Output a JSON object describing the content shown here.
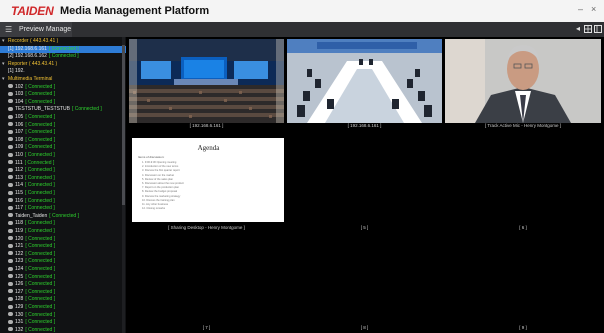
{
  "app": {
    "brand": "TAIDEN",
    "title": "Media Management Platform"
  },
  "window_controls": [
    "–",
    "×"
  ],
  "tabbar": {
    "tab_label": "Preview Manage",
    "tab_icon": "list-icon",
    "right_buttons": [
      "back-icon",
      "grid-view-icon",
      "layout-icon"
    ]
  },
  "sidebar": {
    "items": [
      {
        "level": 0,
        "type": "group",
        "mark": "▾",
        "name": "Recorder ( 443.43.41 )",
        "status": ""
      },
      {
        "level": 1,
        "type": "device",
        "mark": "",
        "name": "[1] 192.168.6.161",
        "status": "[ Connected ]",
        "selected": true
      },
      {
        "level": 1,
        "type": "device",
        "mark": "",
        "name": "[2] 192.168.6.162",
        "status": "[ Connected ]"
      },
      {
        "level": 0,
        "type": "group",
        "mark": "▾",
        "name": "Reporter ( 443.43.41 )",
        "status": ""
      },
      {
        "level": 1,
        "type": "device",
        "mark": "",
        "name": "[1] 192.",
        "status": ""
      },
      {
        "level": 0,
        "type": "group",
        "mark": "▾",
        "name": "Multimedia Terminal",
        "status": ""
      },
      {
        "level": 1,
        "type": "user",
        "name": "102",
        "status": "[ Connected ]"
      },
      {
        "level": 1,
        "type": "user",
        "name": "103",
        "status": "[ Connected ]"
      },
      {
        "level": 1,
        "type": "user",
        "name": "104",
        "status": "[ Connected ]"
      },
      {
        "level": 1,
        "type": "user",
        "name": "TESTSTUB_TESTSTUB",
        "status": "[ Connected ]"
      },
      {
        "level": 1,
        "type": "user",
        "name": "105",
        "status": "[ Connected ]"
      },
      {
        "level": 1,
        "type": "user",
        "name": "106",
        "status": "[ Connected ]"
      },
      {
        "level": 1,
        "type": "user",
        "name": "107",
        "status": "[ Connected ]"
      },
      {
        "level": 1,
        "type": "user",
        "name": "108",
        "status": "[ Connected ]"
      },
      {
        "level": 1,
        "type": "user",
        "name": "109",
        "status": "[ Connected ]"
      },
      {
        "level": 1,
        "type": "user",
        "name": "110",
        "status": "[ Connected ]"
      },
      {
        "level": 1,
        "type": "user",
        "name": "111",
        "status": "[ Connected ]"
      },
      {
        "level": 1,
        "type": "user",
        "name": "112",
        "status": "[ Connected ]"
      },
      {
        "level": 1,
        "type": "user",
        "name": "113",
        "status": "[ Connected ]"
      },
      {
        "level": 1,
        "type": "user",
        "name": "114",
        "status": "[ Connected ]"
      },
      {
        "level": 1,
        "type": "user",
        "name": "115",
        "status": "[ Connected ]"
      },
      {
        "level": 1,
        "type": "user",
        "name": "116",
        "status": "[ Connected ]"
      },
      {
        "level": 1,
        "type": "user",
        "name": "117",
        "status": "[ Connected ]"
      },
      {
        "level": 1,
        "type": "user",
        "name": "Taiden_Taiden",
        "status": "[ Connected ]"
      },
      {
        "level": 1,
        "type": "user",
        "name": "118",
        "status": "[ Connected ]"
      },
      {
        "level": 1,
        "type": "user",
        "name": "119",
        "status": "[ Connected ]"
      },
      {
        "level": 1,
        "type": "user",
        "name": "120",
        "status": "[ Connected ]"
      },
      {
        "level": 1,
        "type": "user",
        "name": "121",
        "status": "[ Connected ]"
      },
      {
        "level": 1,
        "type": "user",
        "name": "122",
        "status": "[ Connected ]"
      },
      {
        "level": 1,
        "type": "user",
        "name": "123",
        "status": "[ Connected ]"
      },
      {
        "level": 1,
        "type": "user",
        "name": "124",
        "status": "[ Connected ]"
      },
      {
        "level": 1,
        "type": "user",
        "name": "125",
        "status": "[ Connected ]"
      },
      {
        "level": 1,
        "type": "user",
        "name": "126",
        "status": "[ Connected ]"
      },
      {
        "level": 1,
        "type": "user",
        "name": "127",
        "status": "[ Connected ]"
      },
      {
        "level": 1,
        "type": "user",
        "name": "128",
        "status": "[ Connected ]"
      },
      {
        "level": 1,
        "type": "user",
        "name": "129",
        "status": "[ Connected ]"
      },
      {
        "level": 1,
        "type": "user",
        "name": "130",
        "status": "[ Connected ]"
      },
      {
        "level": 1,
        "type": "user",
        "name": "131",
        "status": "[ Connected ]"
      },
      {
        "level": 1,
        "type": "user",
        "name": "132",
        "status": "[ Connected ]"
      }
    ]
  },
  "preview_cells": [
    {
      "label": "[ 192.168.6.161 ]",
      "content": "conference-hall-video"
    },
    {
      "label": "[ 192.168.6.161 ]",
      "content": "meeting-room-video"
    },
    {
      "label": "[ Track Active Mic - Henry Montgome ]",
      "content": "speaker-video"
    },
    {
      "label": "[ Sharing Desktop - Henry Montgome ]",
      "content": "shared-document"
    },
    {
      "label": "[ 5 ]",
      "content": "empty"
    },
    {
      "label": "[ 6 ]",
      "content": "empty"
    },
    {
      "label": "[ 7 ]",
      "content": "empty"
    },
    {
      "label": "[ 8 ]",
      "content": "empty"
    },
    {
      "label": "[ 9 ]",
      "content": "empty"
    }
  ],
  "shared_document": {
    "title": "Agenda",
    "subtitle": "Items of discussion:",
    "lines": [
      "1. 9:00-9:30 Opening meeting",
      "2. Introduction of the new terms",
      "3. Discuss the first quarter report",
      "4. Discussion on the market",
      "5. Review of the sales plan",
      "6. Discussion about the new product",
      "7. Report on the production plan",
      "8. Review the budget proposal",
      "9. Discuss the marketing strategy",
      "10. Discuss the training plan",
      "11. Any other business",
      "12. Closing remarks"
    ]
  },
  "colors": {
    "brand_red": "#d0282a",
    "connected_green": "#2ed32e",
    "group_gold": "#f0c033",
    "selection_blue": "#2e7cd6"
  }
}
